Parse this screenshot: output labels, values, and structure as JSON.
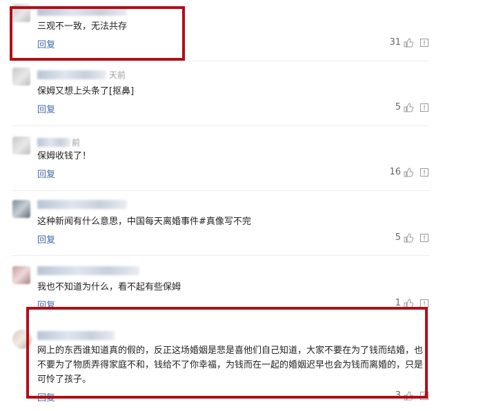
{
  "reply_label": "回复",
  "comments": [
    {
      "time_fragment": "",
      "text": "三观不一致，无法共存",
      "likes": "31"
    },
    {
      "time_fragment": "天前",
      "text": "保姆又想上头条了[抠鼻]",
      "likes": "5"
    },
    {
      "time_fragment": "前",
      "text": "保姆收钱了！",
      "likes": "16"
    },
    {
      "time_fragment": "",
      "text": "这种新闻有什么意思，中国每天离婚事件#真像写不完",
      "likes": "5"
    },
    {
      "time_fragment": "",
      "text": "我也不知道为什么，看不起有些保姆",
      "likes": "1"
    },
    {
      "time_fragment": "",
      "text": "网上的东西谁知道真的假的，反正这场婚姻是悲是喜他们自己知道，大家不要在为了钱而结婚，也不要为了物质弄得家庭不和，钱给不了你幸福，为钱而在一起的婚姻迟早也会为钱而离婚的，只是可怜了孩子。",
      "likes": "3"
    }
  ],
  "colors": {
    "highlight": "#b30d17",
    "reply_link": "#3d6aa8"
  }
}
